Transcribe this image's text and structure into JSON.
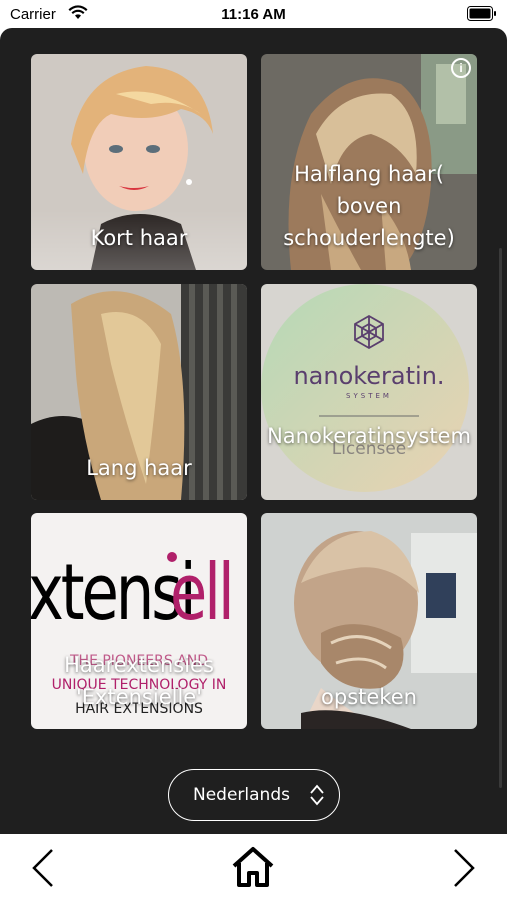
{
  "status_bar": {
    "carrier": "Carrier",
    "time": "11:16 AM"
  },
  "tiles": [
    {
      "label": "Kort haar"
    },
    {
      "label": "Halflang haar( boven schouderlengte)"
    },
    {
      "label": "Lang haar"
    },
    {
      "label": "Nanokeratinsystem"
    },
    {
      "label": "Haarextensies 'Extensielle'"
    },
    {
      "label": "opsteken"
    }
  ],
  "nanokeratin_logo": {
    "brand": "nanokeratin.",
    "sub": "SYSTEM",
    "licensee": "Licensee"
  },
  "extensielle_logo": {
    "brand": "xtensiell",
    "tagline1": "THE PIONEERS AND",
    "tagline2": "UNIQUE TECHNOLOGY IN",
    "tagline3": "HAIR EXTENSIONS"
  },
  "language_selector": {
    "value": "Nederlands"
  },
  "navigation": {
    "back_icon": "chevron-left-icon",
    "home_icon": "home-icon",
    "forward_icon": "chevron-right-icon"
  },
  "colors": {
    "panel_bg": "#1f1f1f",
    "accent_pink": "#b0206a"
  }
}
